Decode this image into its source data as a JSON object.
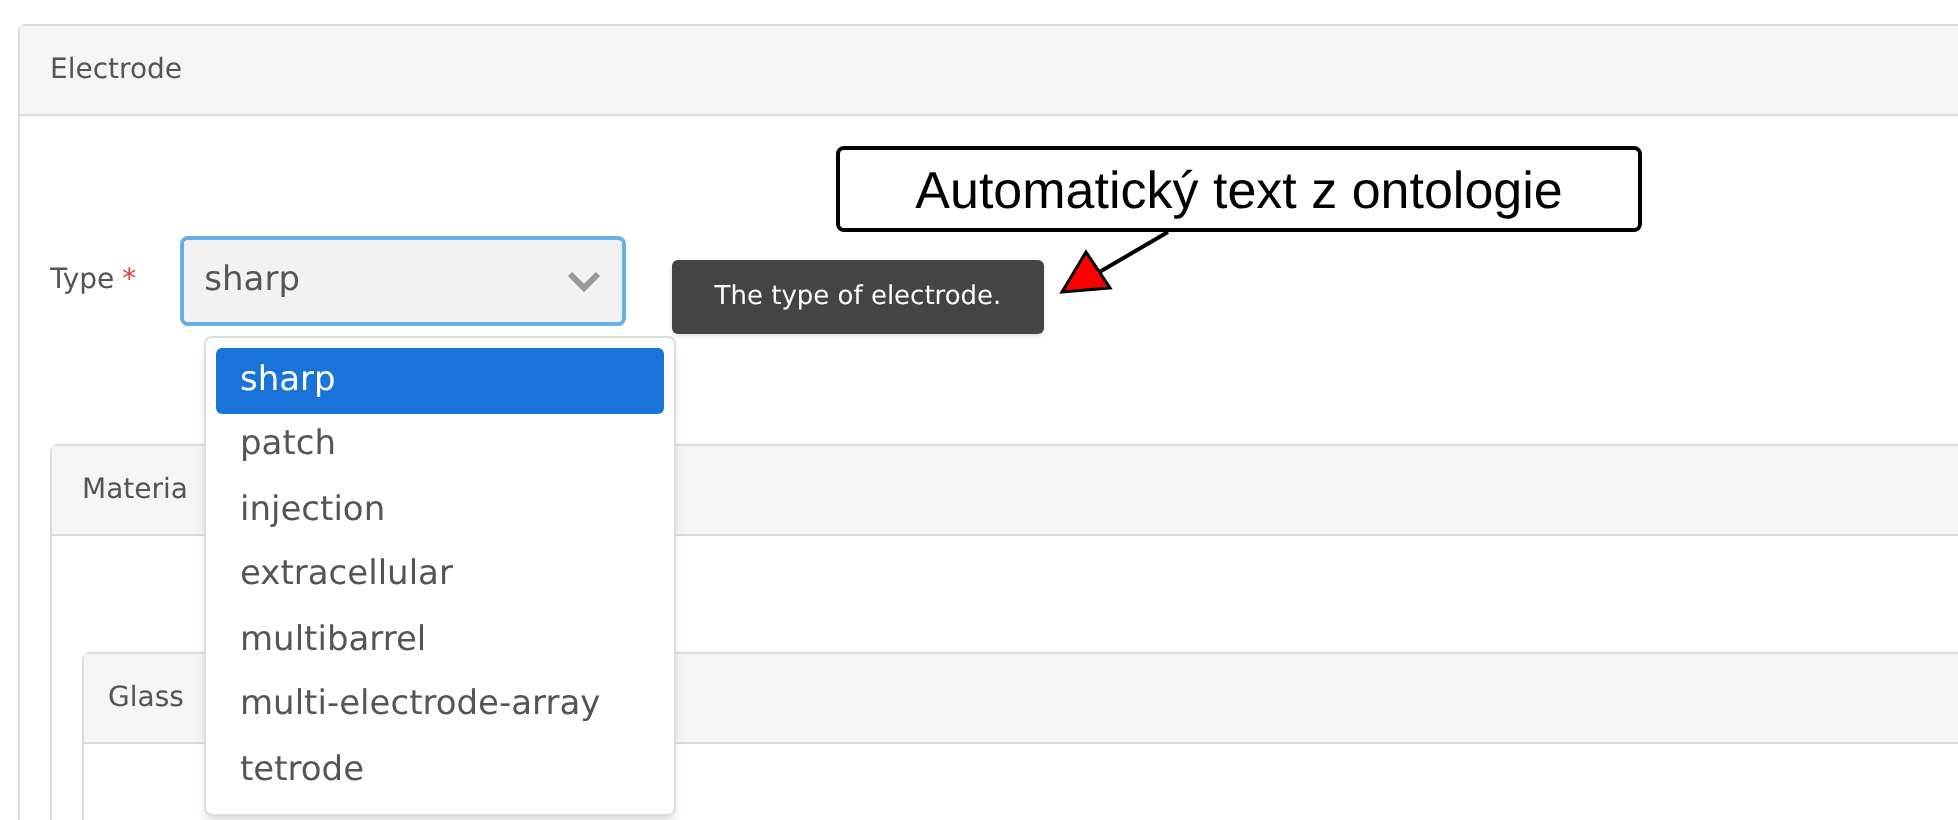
{
  "panel": {
    "title": "Electrode"
  },
  "field": {
    "label": "Type",
    "required_mark": "*",
    "value": "sharp",
    "tooltip": "The type of electrode."
  },
  "dropdown": [
    {
      "label": "sharp",
      "selected": true
    },
    {
      "label": "patch",
      "selected": false
    },
    {
      "label": "injection",
      "selected": false
    },
    {
      "label": "extracellular",
      "selected": false
    },
    {
      "label": "multibarrel",
      "selected": false
    },
    {
      "label": "multi-electrode-array",
      "selected": false
    },
    {
      "label": "tetrode",
      "selected": false
    }
  ],
  "annotation": "Automatický text z ontologie",
  "subpanels": [
    {
      "title": "Materia"
    },
    {
      "title": "Glass"
    }
  ]
}
